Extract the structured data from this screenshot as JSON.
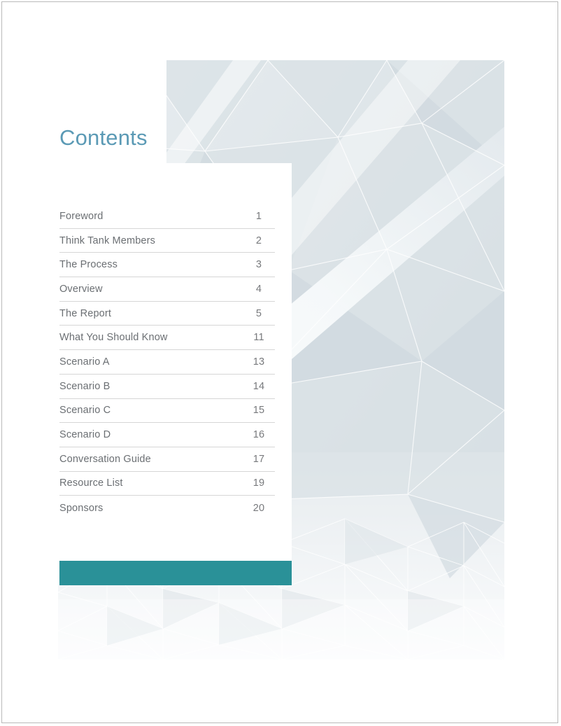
{
  "document": {
    "heading": "Contents",
    "accent_color": "#2a9198",
    "heading_color": "#5b9ab5",
    "text_color": "#6b6f73"
  },
  "toc": {
    "entries": [
      {
        "title": "Foreword",
        "page": "1"
      },
      {
        "title": "Think Tank Members",
        "page": "2"
      },
      {
        "title": "The Process",
        "page": "3"
      },
      {
        "title": "Overview",
        "page": "4"
      },
      {
        "title": "The Report",
        "page": "5"
      },
      {
        "title": "What You Should Know",
        "page": "11"
      },
      {
        "title": "Scenario A",
        "page": "13"
      },
      {
        "title": "Scenario B",
        "page": "14"
      },
      {
        "title": "Scenario C",
        "page": "15"
      },
      {
        "title": "Scenario D",
        "page": "16"
      },
      {
        "title": "Conversation Guide",
        "page": "17"
      },
      {
        "title": "Resource List",
        "page": "19"
      },
      {
        "title": "Sponsors",
        "page": "20"
      }
    ]
  }
}
